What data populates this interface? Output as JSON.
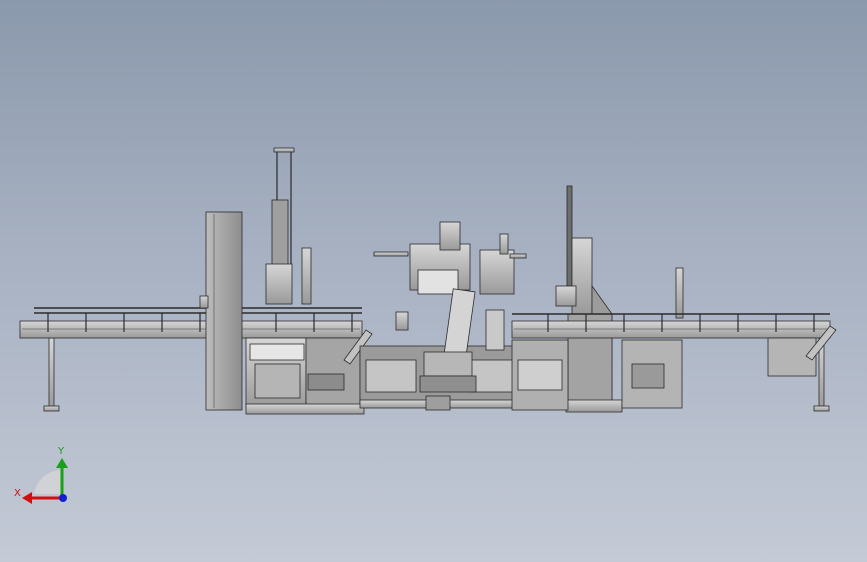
{
  "viewport": {
    "background_top": "#8b99ac",
    "background_bottom": "#c4cad6",
    "model_description_icon": "packaging-line-model"
  },
  "triad": {
    "x_label": "X",
    "y_label": "Y",
    "x_color": "#d01010",
    "y_color": "#18a018",
    "z_color": "#1020d0"
  },
  "palette": {
    "metal_light": "#c9c9c9",
    "metal_mid": "#a8a8a8",
    "metal_dark": "#7a7a7a",
    "edge": "#2b2b2b"
  }
}
